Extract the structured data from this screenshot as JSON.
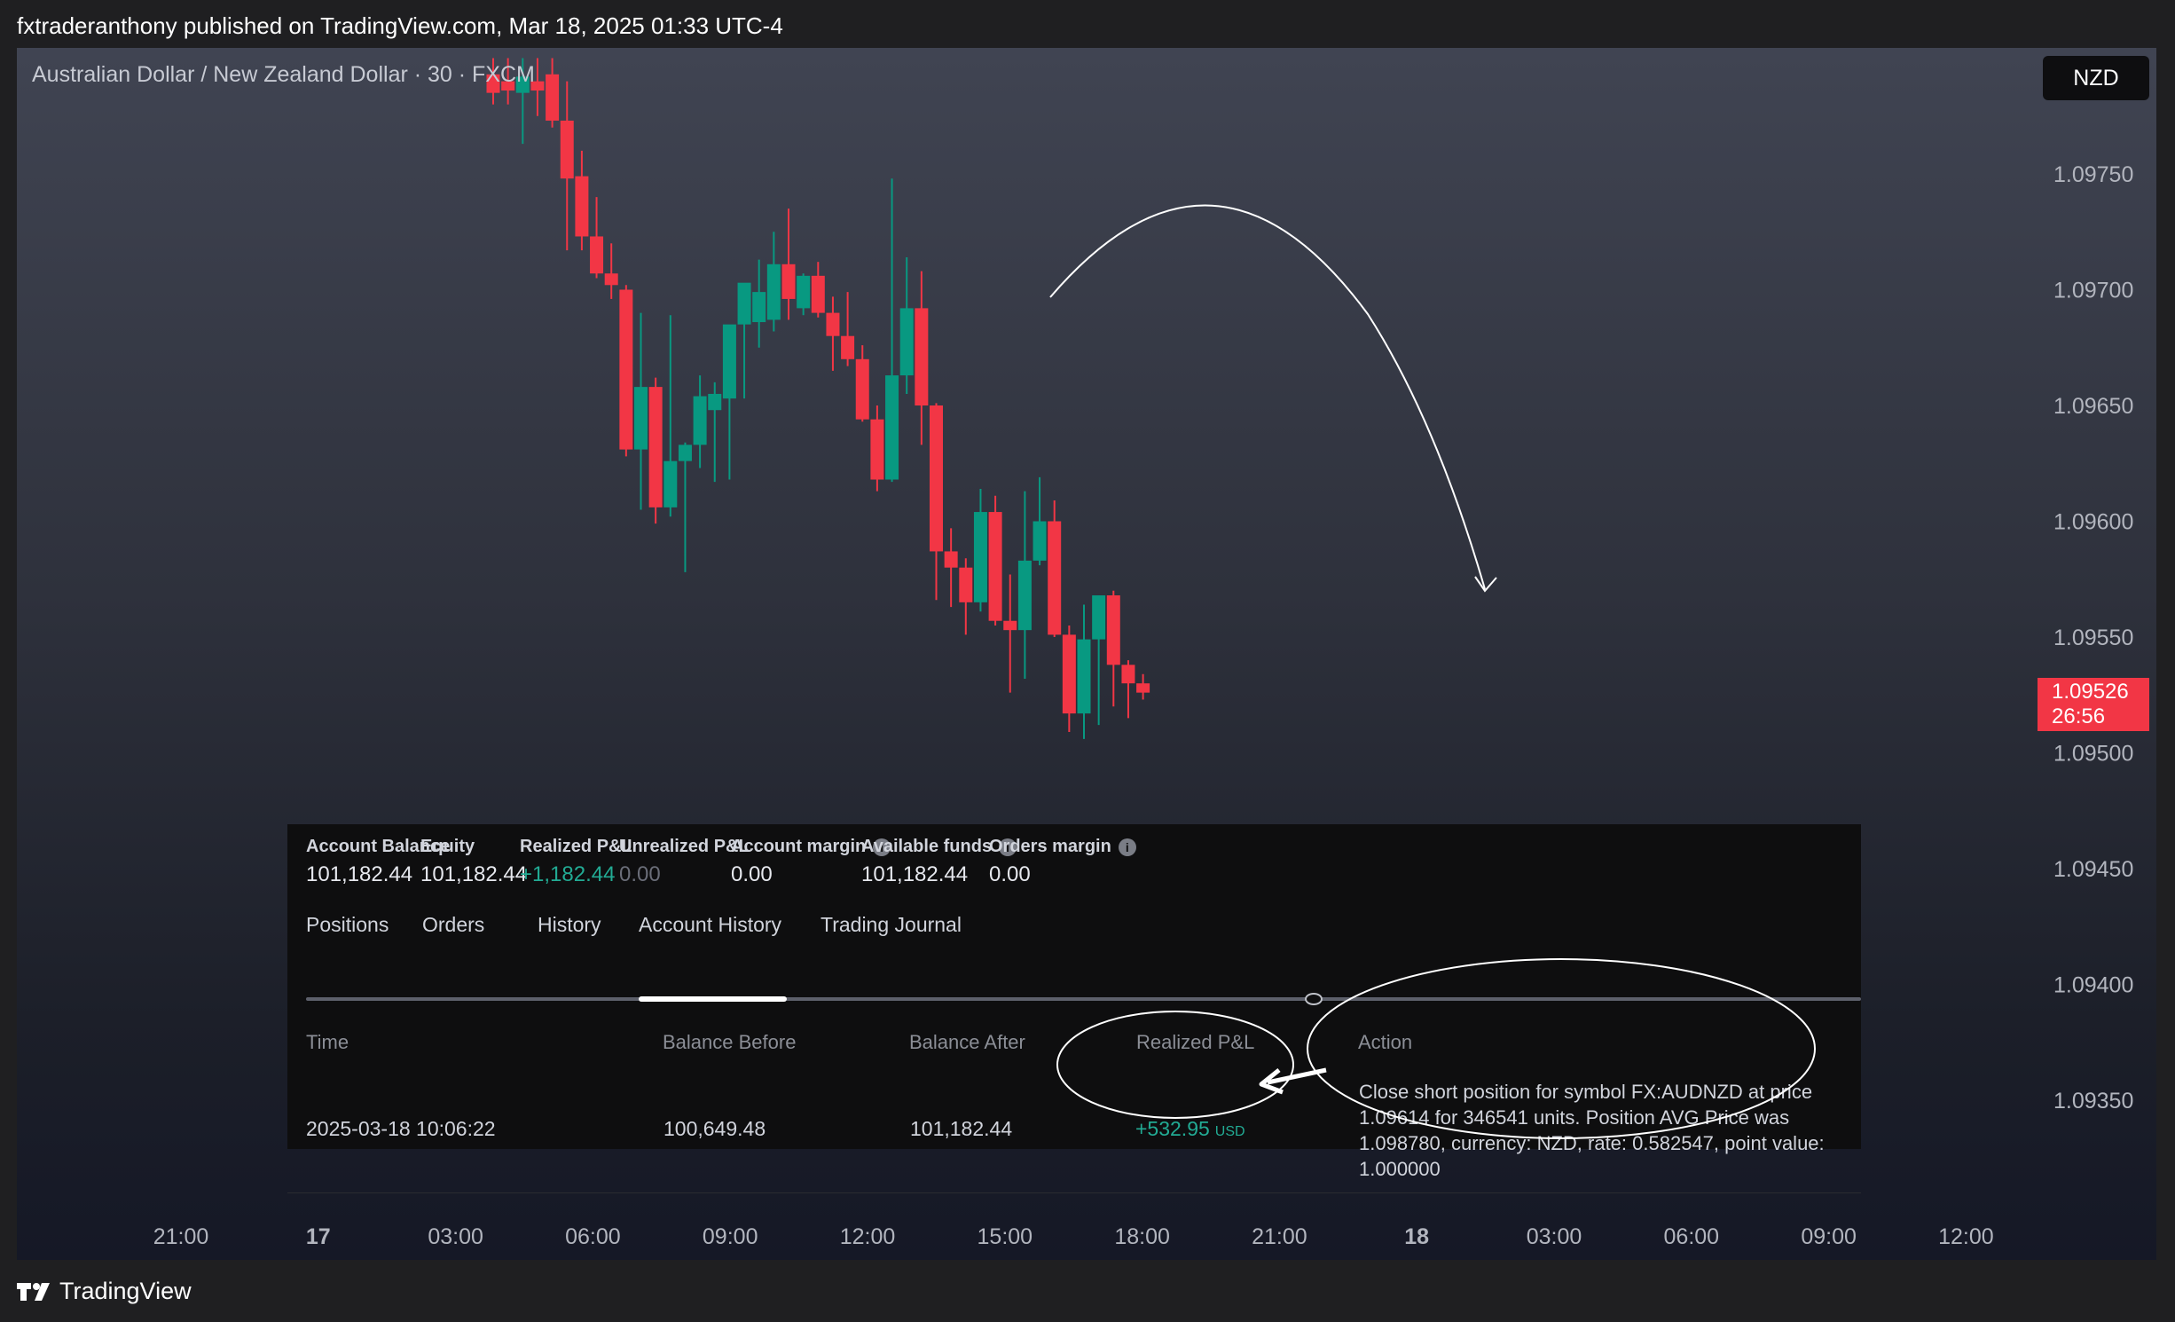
{
  "header": {
    "published_line": "fxtraderanthony published on TradingView.com, Mar 18, 2025 01:33 UTC-4"
  },
  "chart": {
    "symbol_title": "Australian Dollar / New Zealand Dollar · 30 · FXCM",
    "currency": "NZD",
    "current_price": "1.09526",
    "countdown": "26:56",
    "colors": {
      "up": "#089981",
      "down": "#f23645",
      "annotation": "#ffffff"
    }
  },
  "chart_data": {
    "type": "candlestick",
    "y_axis": {
      "labels": [
        "1.09750",
        "1.09700",
        "1.09650",
        "1.09600",
        "1.09550",
        "1.09500",
        "1.09450",
        "1.09400",
        "1.09350"
      ],
      "ylim": [
        1.0933,
        1.0981
      ]
    },
    "x_axis": {
      "labels": [
        "21:00",
        "17",
        "03:00",
        "06:00",
        "09:00",
        "12:00",
        "15:00",
        "18:00",
        "21:00",
        "18",
        "03:00",
        "06:00",
        "09:00",
        "12:00"
      ]
    },
    "candles": [
      {
        "o": 1.09793,
        "h": 1.098,
        "l": 1.0978,
        "c": 1.09785
      },
      {
        "o": 1.0979,
        "h": 1.098,
        "l": 1.0978,
        "c": 1.09786
      },
      {
        "o": 1.09785,
        "h": 1.098,
        "l": 1.09763,
        "c": 1.09792
      },
      {
        "o": 1.0979,
        "h": 1.098,
        "l": 1.09775,
        "c": 1.09786
      },
      {
        "o": 1.09793,
        "h": 1.098,
        "l": 1.0977,
        "c": 1.09773
      },
      {
        "o": 1.09773,
        "h": 1.0979,
        "l": 1.09717,
        "c": 1.09748
      },
      {
        "o": 1.09749,
        "h": 1.0976,
        "l": 1.09717,
        "c": 1.09723
      },
      {
        "o": 1.09723,
        "h": 1.0974,
        "l": 1.09705,
        "c": 1.09707
      },
      {
        "o": 1.09707,
        "h": 1.0972,
        "l": 1.09696,
        "c": 1.09702
      },
      {
        "o": 1.097,
        "h": 1.09702,
        "l": 1.09628,
        "c": 1.09631
      },
      {
        "o": 1.09631,
        "h": 1.0969,
        "l": 1.09605,
        "c": 1.09658
      },
      {
        "o": 1.09658,
        "h": 1.09662,
        "l": 1.09599,
        "c": 1.09606
      },
      {
        "o": 1.09606,
        "h": 1.09689,
        "l": 1.09602,
        "c": 1.09626
      },
      {
        "o": 1.09626,
        "h": 1.09634,
        "l": 1.09578,
        "c": 1.09633
      },
      {
        "o": 1.09633,
        "h": 1.09663,
        "l": 1.09623,
        "c": 1.09654
      },
      {
        "o": 1.09648,
        "h": 1.0966,
        "l": 1.09617,
        "c": 1.09655
      },
      {
        "o": 1.09653,
        "h": 1.09668,
        "l": 1.09618,
        "c": 1.09685
      },
      {
        "o": 1.09685,
        "h": 1.09702,
        "l": 1.09653,
        "c": 1.09703
      },
      {
        "o": 1.09686,
        "h": 1.09713,
        "l": 1.09675,
        "c": 1.09699
      },
      {
        "o": 1.09687,
        "h": 1.09725,
        "l": 1.09682,
        "c": 1.09711
      },
      {
        "o": 1.09711,
        "h": 1.09735,
        "l": 1.09687,
        "c": 1.09696
      },
      {
        "o": 1.09692,
        "h": 1.09707,
        "l": 1.09689,
        "c": 1.09706
      },
      {
        "o": 1.09706,
        "h": 1.09712,
        "l": 1.09688,
        "c": 1.0969
      },
      {
        "o": 1.0969,
        "h": 1.09697,
        "l": 1.09665,
        "c": 1.0968
      },
      {
        "o": 1.0968,
        "h": 1.09699,
        "l": 1.09667,
        "c": 1.0967
      },
      {
        "o": 1.0967,
        "h": 1.09676,
        "l": 1.09643,
        "c": 1.09644
      },
      {
        "o": 1.09644,
        "h": 1.0965,
        "l": 1.09613,
        "c": 1.09618
      },
      {
        "o": 1.09618,
        "h": 1.09748,
        "l": 1.09617,
        "c": 1.09663
      },
      {
        "o": 1.09663,
        "h": 1.09714,
        "l": 1.09655,
        "c": 1.09692
      },
      {
        "o": 1.09692,
        "h": 1.09708,
        "l": 1.09633,
        "c": 1.0965
      },
      {
        "o": 1.0965,
        "h": 1.09651,
        "l": 1.09566,
        "c": 1.09587
      },
      {
        "o": 1.09587,
        "h": 1.09597,
        "l": 1.09563,
        "c": 1.0958
      },
      {
        "o": 1.0958,
        "h": 1.09584,
        "l": 1.09551,
        "c": 1.09565
      },
      {
        "o": 1.09565,
        "h": 1.09614,
        "l": 1.09561,
        "c": 1.09604
      },
      {
        "o": 1.09604,
        "h": 1.09611,
        "l": 1.09555,
        "c": 1.09557
      },
      {
        "o": 1.09557,
        "h": 1.09577,
        "l": 1.09526,
        "c": 1.09553
      },
      {
        "o": 1.09553,
        "h": 1.09613,
        "l": 1.09532,
        "c": 1.09583
      },
      {
        "o": 1.09583,
        "h": 1.09619,
        "l": 1.09581,
        "c": 1.096
      },
      {
        "o": 1.096,
        "h": 1.09609,
        "l": 1.0955,
        "c": 1.09551
      },
      {
        "o": 1.09551,
        "h": 1.09555,
        "l": 1.09509,
        "c": 1.09517
      },
      {
        "o": 1.09517,
        "h": 1.09564,
        "l": 1.09506,
        "c": 1.09549
      },
      {
        "o": 1.09549,
        "h": 1.09568,
        "l": 1.09512,
        "c": 1.09568
      },
      {
        "o": 1.09568,
        "h": 1.0957,
        "l": 1.0952,
        "c": 1.09538
      },
      {
        "o": 1.09538,
        "h": 1.0954,
        "l": 1.09515,
        "c": 1.0953
      },
      {
        "o": 1.0953,
        "h": 1.09534,
        "l": 1.09523,
        "c": 1.09526
      }
    ]
  },
  "account": {
    "items": [
      {
        "label": "Account Balance",
        "value": "101,182.44",
        "info": false,
        "tone": "normal"
      },
      {
        "label": "Equity",
        "value": "101,182.44",
        "info": false,
        "tone": "normal"
      },
      {
        "label": "Realized P&L",
        "value": "+1,182.44",
        "info": false,
        "tone": "green"
      },
      {
        "label": "Unrealized P&L",
        "value": "0.00",
        "info": false,
        "tone": "muted"
      },
      {
        "label": "Account margin",
        "value": "0.00",
        "info": true,
        "tone": "normal"
      },
      {
        "label": "Available funds",
        "value": "101,182.44",
        "info": true,
        "tone": "normal"
      },
      {
        "label": "Orders margin",
        "value": "0.00",
        "info": true,
        "tone": "normal"
      }
    ]
  },
  "tabs": [
    "Positions",
    "Orders",
    "History",
    "Account History",
    "Trading Journal"
  ],
  "history": {
    "columns": [
      "Time",
      "Balance Before",
      "Balance After",
      "Realized P&L",
      "Action"
    ],
    "row": {
      "time": "2025-03-18 10:06:22",
      "balance_before": "100,649.48",
      "balance_after": "101,182.44",
      "realized_pnl": "+532.95",
      "pnl_currency": "USD",
      "action": "Close short position for symbol FX:AUDNZD at price 1.09614 for 346541 units. Position AVG Price was 1.098780, currency: NZD, rate: 0.582547, point value: 1.000000"
    }
  },
  "footer": {
    "brand": "TradingView"
  }
}
